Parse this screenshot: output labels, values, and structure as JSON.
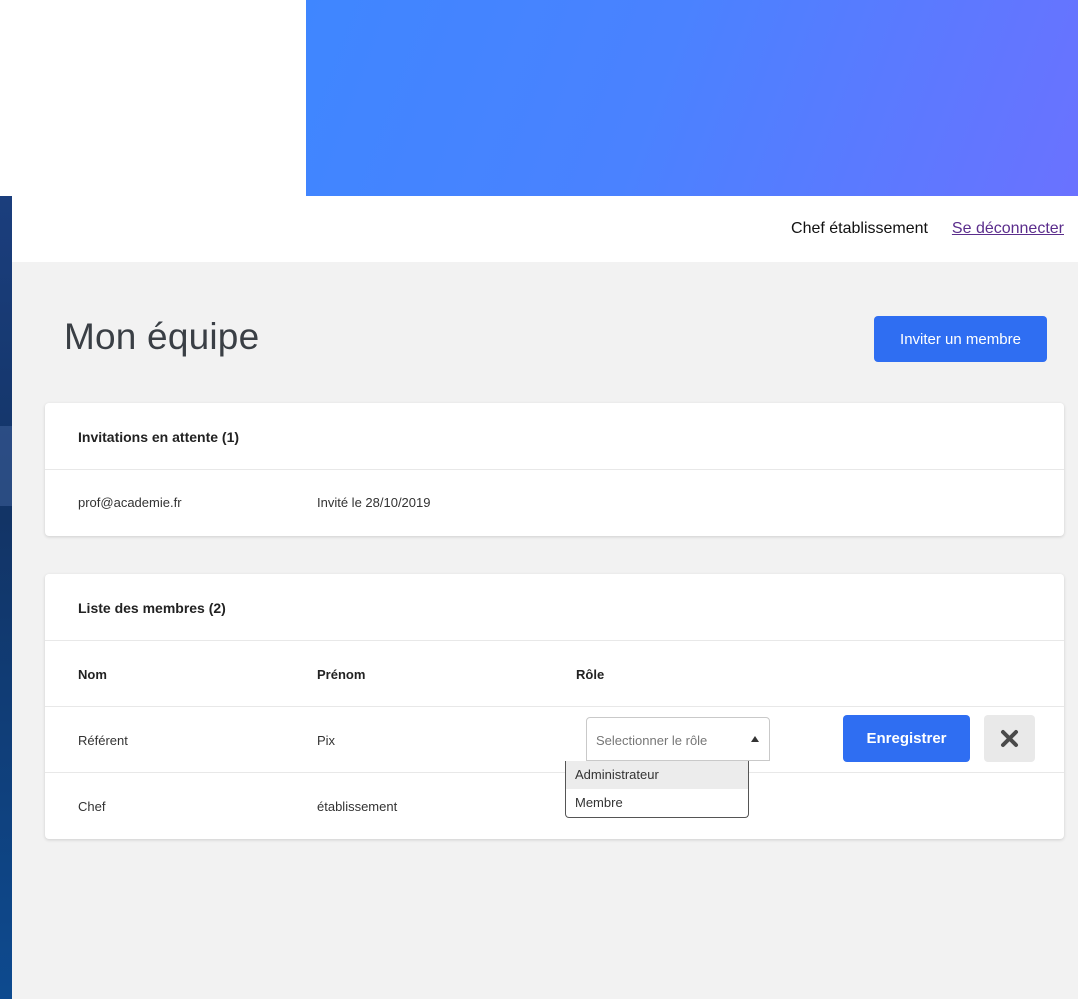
{
  "header": {
    "user_name": "Chef établissement",
    "logout_label": "Se déconnecter"
  },
  "page": {
    "title": "Mon équipe",
    "invite_button_label": "Inviter un membre"
  },
  "invitations": {
    "title": "Invitations en attente (1)",
    "items": [
      {
        "email": "prof@academie.fr",
        "date": "Invité le 28/10/2019"
      }
    ]
  },
  "members": {
    "title": "Liste des membres (2)",
    "columns": {
      "nom": "Nom",
      "prenom": "Prénom",
      "role": "Rôle"
    },
    "rows": [
      {
        "nom": "Référent",
        "prenom": "Pix"
      },
      {
        "nom": "Chef",
        "prenom": "établissement"
      }
    ],
    "role_select": {
      "placeholder": "Selectionner le rôle",
      "options": [
        "Administrateur",
        "Membre"
      ]
    },
    "save_label": "Enregistrer"
  },
  "colors": {
    "primary": "#2f6ef2",
    "banner_start": "#3f86ff",
    "banner_end": "#6a72ff",
    "background": "#f2f2f2",
    "link": "#5b2d8c"
  },
  "icons": {
    "close": "close-icon",
    "caret": "caret-up-icon"
  }
}
